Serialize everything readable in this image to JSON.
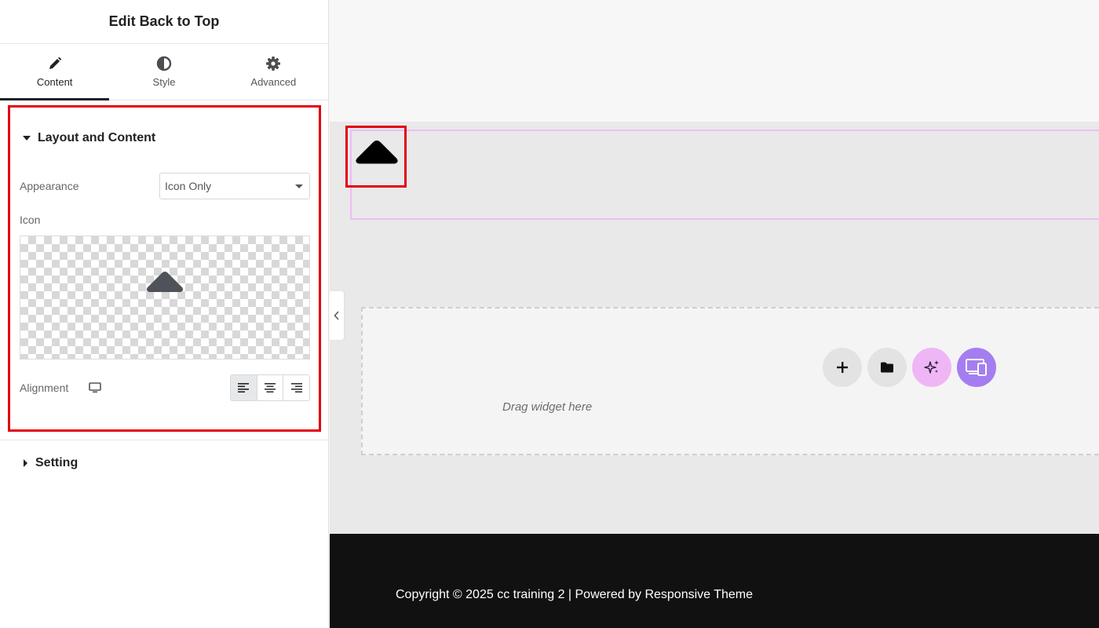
{
  "panel": {
    "title": "Edit Back to Top",
    "tabs": [
      {
        "label": "Content",
        "icon": "pencil-icon",
        "active": true
      },
      {
        "label": "Style",
        "icon": "half-circle-icon",
        "active": false
      },
      {
        "label": "Advanced",
        "icon": "gear-icon",
        "active": false
      }
    ],
    "section_layout": {
      "title": "Layout and Content",
      "appearance_label": "Appearance",
      "appearance_value": "Icon Only",
      "icon_label": "Icon",
      "alignment_label": "Alignment",
      "alignment_options": [
        "left",
        "center",
        "right"
      ],
      "alignment_selected": "left"
    },
    "section_setting": {
      "title": "Setting"
    }
  },
  "canvas": {
    "dropzone_text": "Drag widget here",
    "dropzone_buttons": [
      "plus-icon",
      "folder-icon",
      "sparkles-icon",
      "responsive-icon"
    ],
    "footer_text": "Copyright © 2025 cc training 2 | Powered by Responsive Theme"
  },
  "colors": {
    "highlight_red": "#e3000f",
    "pink_outline": "#eebcf2",
    "ai_pink": "#efb6f5",
    "purple": "#a47ef0",
    "footer_bg": "#111111"
  }
}
